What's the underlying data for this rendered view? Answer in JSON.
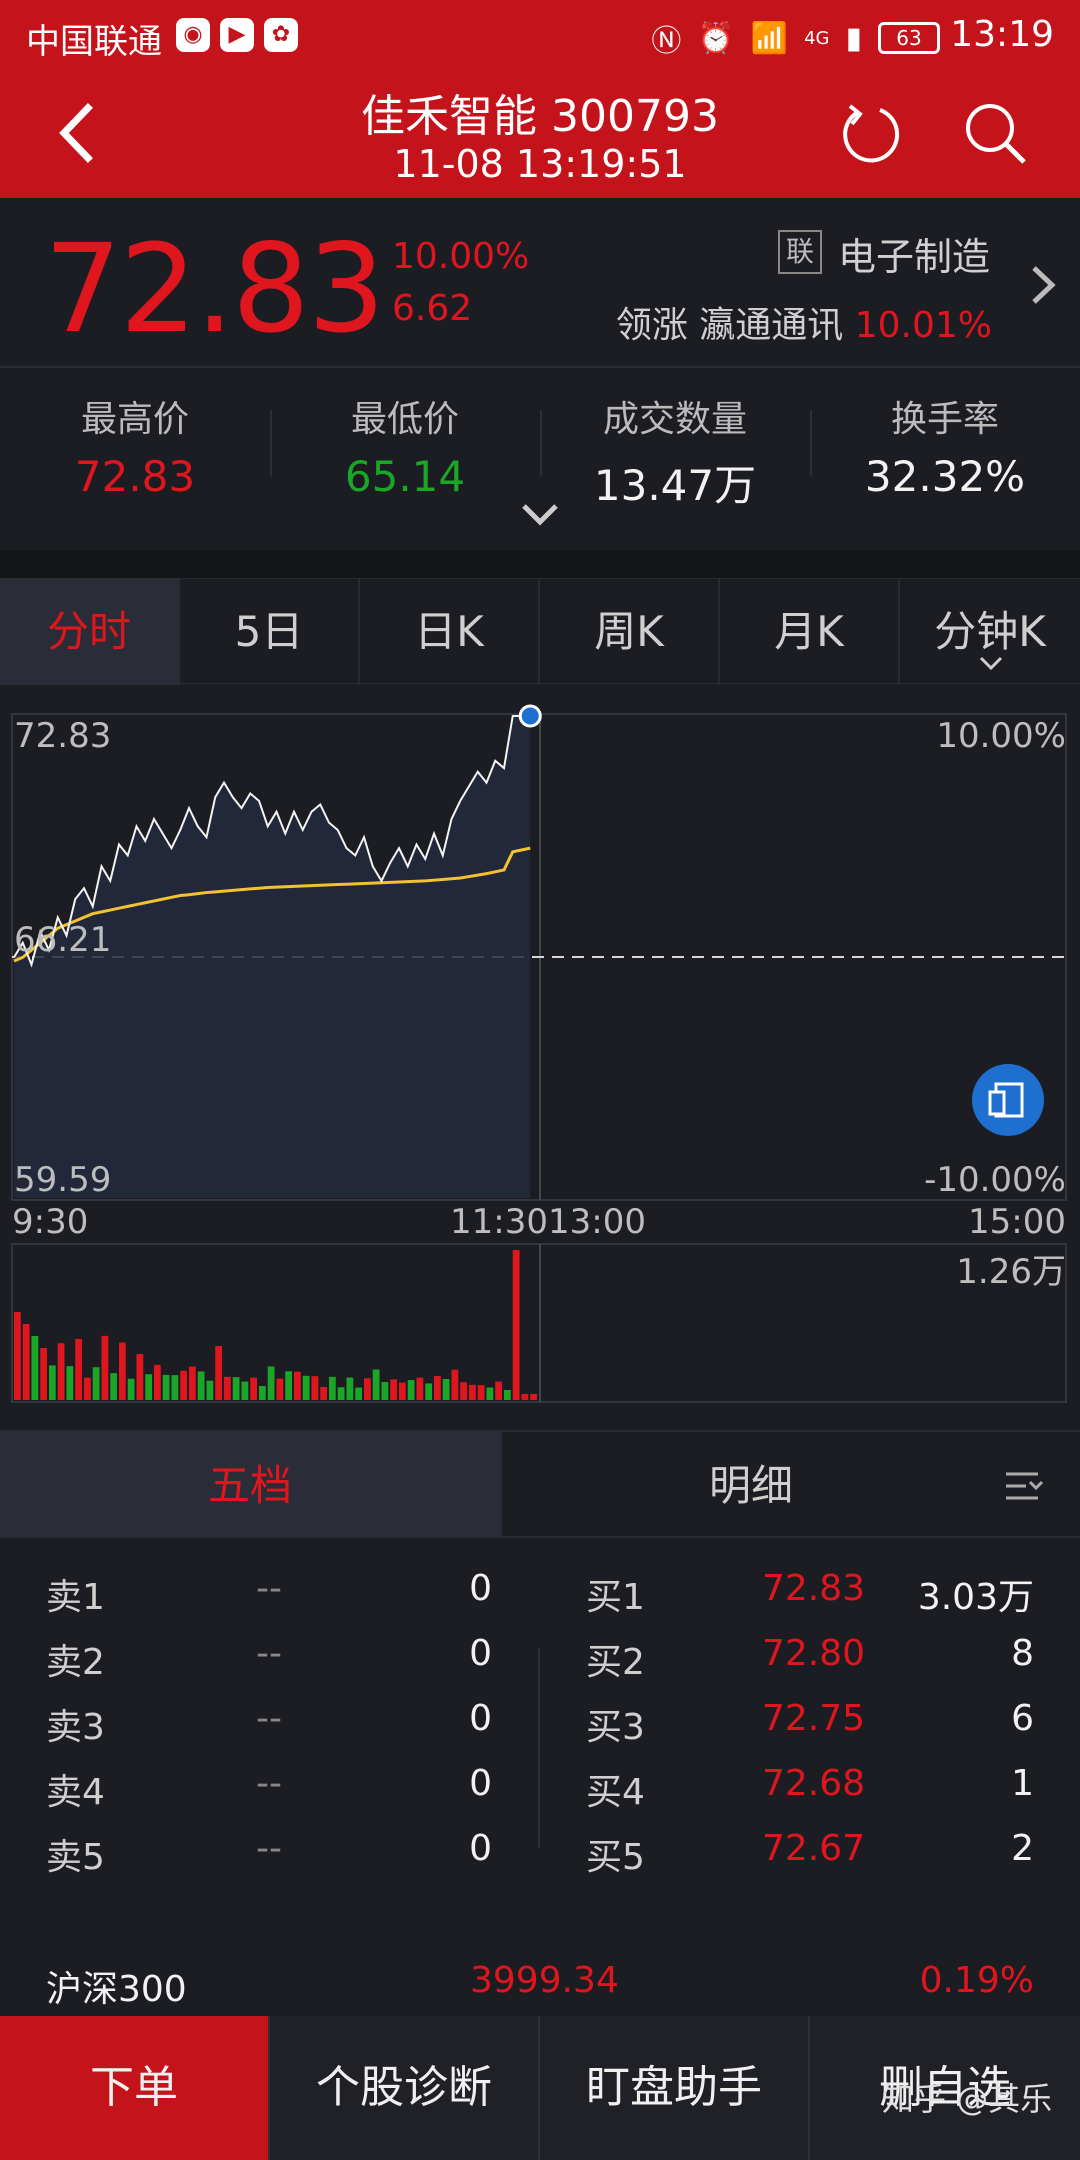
{
  "status_bar": {
    "carrier": "中国联通",
    "time": "13:19",
    "battery": "63",
    "network": "4G"
  },
  "header": {
    "title": "佳禾智能 300793",
    "subtitle": "11-08 13:19:51"
  },
  "quote": {
    "price": "72.83",
    "change_pct": "10.00%",
    "change_val": "6.62",
    "sector_badge": "联",
    "sector": "电子制造",
    "leader_label": "领涨 瀛通通讯",
    "leader_pct": "10.01%"
  },
  "stats": [
    {
      "label": "最高价",
      "value": "72.83",
      "color": "#e0161e"
    },
    {
      "label": "最低价",
      "value": "65.14",
      "color": "#1aa728"
    },
    {
      "label": "成交数量",
      "value": "13.47万",
      "color": "#f2f2f2"
    },
    {
      "label": "换手率",
      "value": "32.32%",
      "color": "#f2f2f2"
    }
  ],
  "chart_tabs": [
    "分时",
    "5日",
    "日K",
    "周K",
    "月K",
    "分钟K"
  ],
  "chart_axis": {
    "y_top": "72.83",
    "y_mid": "66.21",
    "y_bottom": "59.59",
    "pct_top": "10.00%",
    "pct_bottom": "-10.00%",
    "x_start": "9:30",
    "x_mid": "11:3013:00",
    "x_end": "15:00",
    "vol_max": "1.26万"
  },
  "chart_data": {
    "type": "line",
    "ylim": [
      59.59,
      72.83
    ],
    "prev_close": 66.21,
    "series": [
      {
        "values": [
          66.2,
          66.6,
          66.0,
          66.9,
          66.4,
          67.3,
          66.8,
          67.8,
          68.1,
          67.6,
          68.7,
          68.3,
          69.3,
          69.0,
          69.8,
          69.4,
          70.0,
          69.6,
          69.2,
          69.7,
          70.3,
          69.8,
          69.5,
          70.6,
          71.0,
          70.6,
          70.3,
          70.7,
          70.5,
          69.8,
          70.2,
          69.6,
          70.2,
          69.7,
          70.2,
          70.4,
          69.9,
          69.7,
          69.2,
          69.0,
          69.5,
          68.7,
          68.3,
          68.8,
          69.2,
          68.7,
          69.3,
          68.9,
          69.6,
          69.0,
          70.0,
          70.5,
          70.9,
          71.3,
          71.0,
          71.6,
          71.4,
          72.83,
          72.83,
          72.83
        ]
      },
      {
        "values": [
          66.1,
          66.2,
          66.4,
          66.6,
          66.8,
          67.0,
          67.1,
          67.2,
          67.3,
          67.4,
          67.45,
          67.5,
          67.55,
          67.6,
          67.65,
          67.7,
          67.75,
          67.8,
          67.85,
          67.9,
          67.92,
          67.95,
          67.98,
          68.0,
          68.02,
          68.04,
          68.06,
          68.08,
          68.1,
          68.12,
          68.13,
          68.14,
          68.15,
          68.16,
          68.17,
          68.18,
          68.19,
          68.2,
          68.21,
          68.22,
          68.23,
          68.24,
          68.25,
          68.26,
          68.27,
          68.28,
          68.29,
          68.3,
          68.32,
          68.34,
          68.36,
          68.38,
          68.42,
          68.46,
          68.5,
          68.55,
          68.6,
          69.1,
          69.15,
          69.2
        ]
      }
    ]
  },
  "order_tabs": [
    "五档",
    "明细"
  ],
  "asks": [
    {
      "label": "卖1",
      "price": "--",
      "vol": "0"
    },
    {
      "label": "卖2",
      "price": "--",
      "vol": "0"
    },
    {
      "label": "卖3",
      "price": "--",
      "vol": "0"
    },
    {
      "label": "卖4",
      "price": "--",
      "vol": "0"
    },
    {
      "label": "卖5",
      "price": "--",
      "vol": "0"
    }
  ],
  "bids": [
    {
      "label": "买1",
      "price": "72.83",
      "vol": "3.03万"
    },
    {
      "label": "买2",
      "price": "72.80",
      "vol": "8"
    },
    {
      "label": "买3",
      "price": "72.75",
      "vol": "6"
    },
    {
      "label": "买4",
      "price": "72.68",
      "vol": "1"
    },
    {
      "label": "买5",
      "price": "72.67",
      "vol": "2"
    }
  ],
  "index": {
    "name": "沪深300",
    "value": "3999.34",
    "pct": "0.19%"
  },
  "bottom_bar": [
    "下单",
    "个股诊断",
    "盯盘助手",
    "删自选"
  ],
  "watermark": "知乎 @其乐"
}
